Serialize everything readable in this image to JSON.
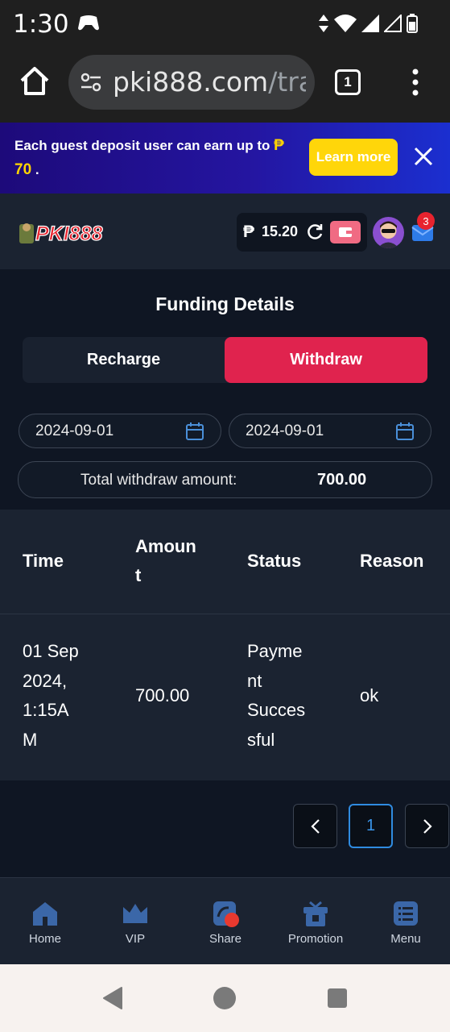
{
  "status_bar": {
    "time": "1:30"
  },
  "browser": {
    "url_main": "pki888.com",
    "url_rest": "/tra",
    "tab_count": "1"
  },
  "promo": {
    "text": "Each guest deposit user can earn up to",
    "currency": "₱",
    "amount": "70",
    "suffix": ".",
    "learn_more": "Learn more"
  },
  "header": {
    "logo_text": "PKI888",
    "currency": "₱",
    "balance": "15.20",
    "mail_badge": "3"
  },
  "page": {
    "title": "Funding Details",
    "tabs": [
      {
        "label": "Recharge",
        "active": false
      },
      {
        "label": "Withdraw",
        "active": true
      }
    ],
    "date_start": "2024-09-01",
    "date_end": "2024-09-01",
    "total_label": "Total withdraw amount:",
    "total_value": "700.00"
  },
  "table": {
    "headers": {
      "time_line1": "Time",
      "amount_line1": "Amoun",
      "amount_line2": "t",
      "status": "Status",
      "reason": "Reason"
    },
    "rows": [
      {
        "time_lines": [
          "01 Sep",
          "2024,",
          "1:15A",
          "M"
        ],
        "amount": "700.00",
        "status_lines": [
          "Payme",
          "nt",
          "Succes",
          "sful"
        ],
        "reason": "ok"
      }
    ]
  },
  "pager": {
    "prev": "<",
    "page": "1",
    "next": ">"
  },
  "bottom_nav": [
    {
      "label": "Home",
      "icon": "home-icon"
    },
    {
      "label": "VIP",
      "icon": "crown-icon"
    },
    {
      "label": "Share",
      "icon": "share-icon"
    },
    {
      "label": "Promotion",
      "icon": "gift-icon"
    },
    {
      "label": "Menu",
      "icon": "menu-icon"
    }
  ],
  "colors": {
    "accent": "#e0234e",
    "promo_button": "#ffd60a",
    "link_blue": "#3a95ea"
  }
}
